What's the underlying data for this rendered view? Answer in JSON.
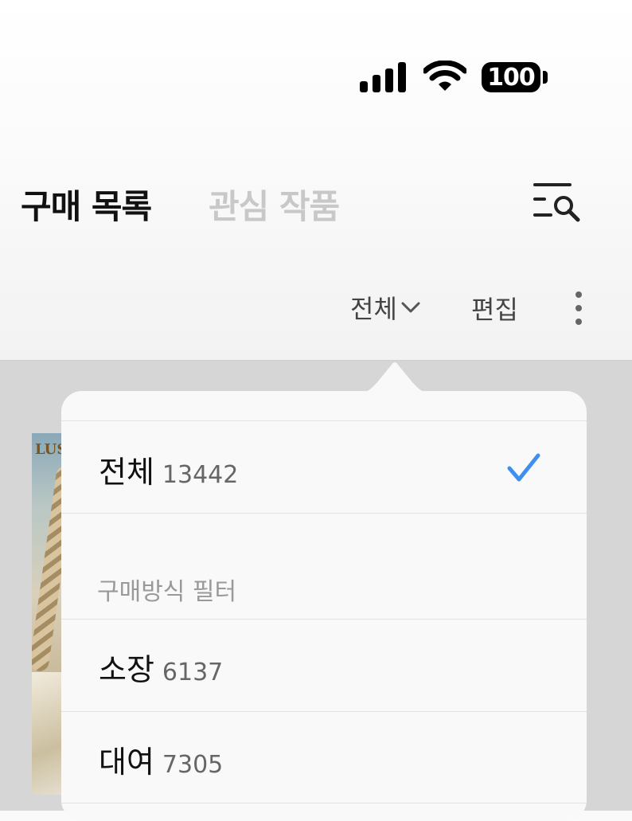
{
  "status_bar": {
    "battery": "100"
  },
  "tabs": {
    "purchase": "구매 목록",
    "interest": "관심 작품"
  },
  "toolbar": {
    "filter_label": "전체",
    "edit_label": "편집"
  },
  "background_book": {
    "title_fragment": "LUST"
  },
  "dropdown": {
    "all": {
      "label": "전체",
      "count": "13442",
      "selected": true
    },
    "section_header": "구매방식 필터",
    "options": [
      {
        "label": "소장",
        "count": "6137"
      },
      {
        "label": "대여",
        "count": "7305"
      }
    ]
  },
  "icons": {
    "signal": "cellular-signal-icon",
    "wifi": "wifi-icon",
    "battery": "battery-icon",
    "search": "list-search-icon",
    "filter_chevron": "chevron-down-icon",
    "more": "more-vertical-icon",
    "check": "checkmark-icon"
  },
  "colors": {
    "accent": "#3f8ff0",
    "inactive_tab": "#c8c8c8"
  }
}
